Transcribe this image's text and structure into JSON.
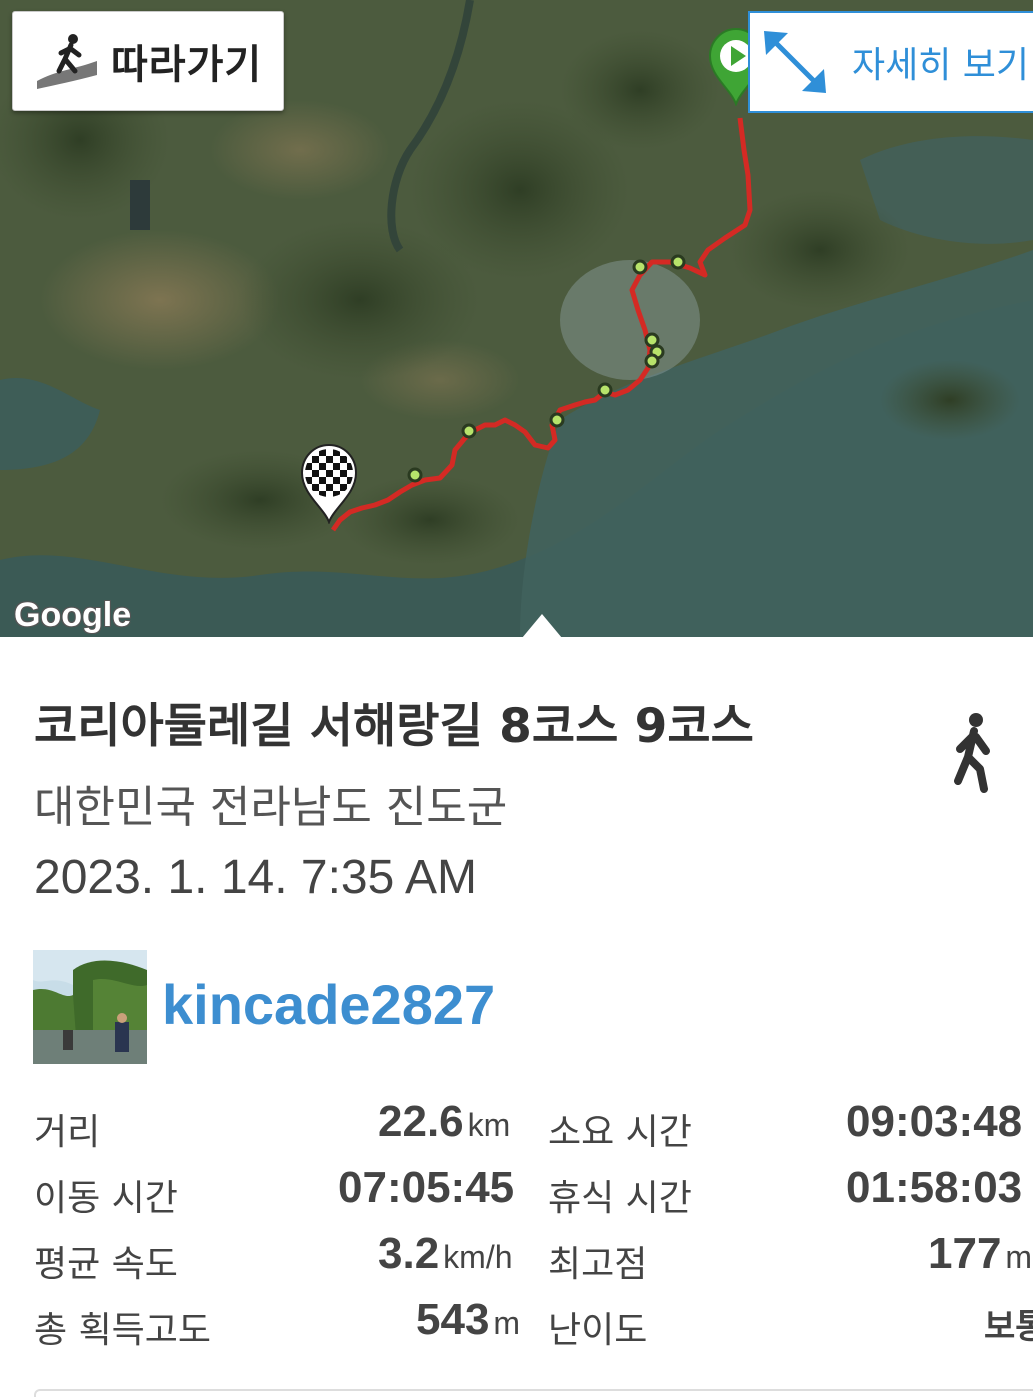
{
  "map": {
    "follow_label": "따라가기",
    "detail_label": "자세히 보기",
    "google_label": "Google",
    "colors": {
      "route": "#d42a24",
      "start_marker": "#3fa535",
      "waypoint": "#b7e36b",
      "accent": "#2f8fd8"
    }
  },
  "trail": {
    "title": "코리아둘레길 서해랑길 8코스 9코스",
    "location": "대한민국 전라남도 진도군",
    "datetime": "2023. 1. 14. 7:35 AM",
    "activity_icon": "walking-person-icon"
  },
  "user": {
    "name": "kincade2827",
    "avatar_icon": "avatar-photo"
  },
  "stats": {
    "distance": {
      "label": "거리",
      "value": "22.6",
      "unit": "km"
    },
    "total_time": {
      "label": "소요 시간",
      "value": "09:03:48"
    },
    "moving_time": {
      "label": "이동 시간",
      "value": "07:05:45"
    },
    "rest_time": {
      "label": "휴식 시간",
      "value": "01:58:03"
    },
    "avg_speed": {
      "label": "평균 속도",
      "value": "3.2",
      "unit": "km/h"
    },
    "max_elevation": {
      "label": "최고점",
      "value": "177",
      "unit": "m"
    },
    "total_ascent": {
      "label": "총 획득고도",
      "value": "543",
      "unit": "m"
    },
    "difficulty": {
      "label": "난이도",
      "value": "보통"
    }
  }
}
